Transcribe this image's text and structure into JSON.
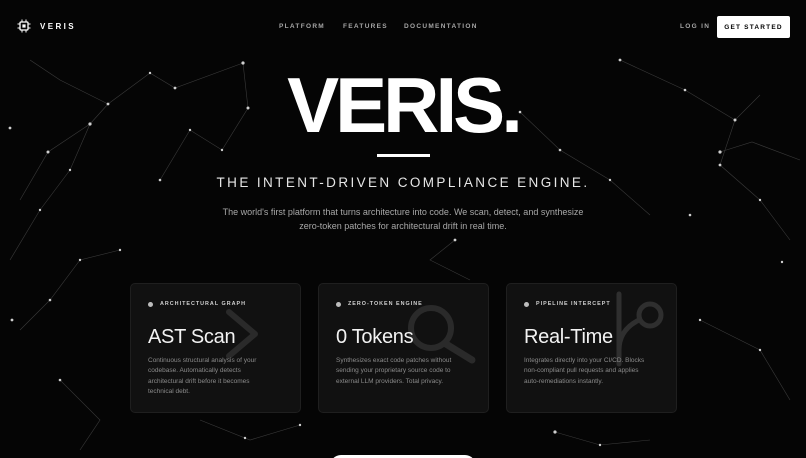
{
  "nav": {
    "brand": "VERIS",
    "links": [
      "PLATFORM",
      "FEATURES",
      "DOCUMENTATION"
    ],
    "login": "LOG IN",
    "cta": "GET STARTED"
  },
  "hero": {
    "title": "VERIS.",
    "subtitle": "THE INTENT-DRIVEN COMPLIANCE ENGINE.",
    "description": "The world's first platform that turns architecture into code. We scan, detect, and synthesize zero-token patches for architectural drift in real time."
  },
  "cards": [
    {
      "label": "ARCHITECTURAL GRAPH",
      "title": "AST Scan",
      "body": "Continuous structural analysis of your codebase. Automatically detects architectural drift before it becomes technical debt.",
      "art_icon": "chevron-icon"
    },
    {
      "label": "ZERO-TOKEN ENGINE",
      "title": "0 Tokens",
      "body": "Synthesizes exact code patches without sending your proprietary source code to external LLM providers. Total privacy.",
      "art_icon": "magnifier-icon"
    },
    {
      "label": "PIPELINE INTERCEPT",
      "title": "Real-Time",
      "body": "Integrates directly into your CI/CD. Blocks non-compliant pull requests and applies auto-remediations instantly.",
      "art_icon": "git-branch-icon"
    }
  ],
  "colors": {
    "background": "#050505",
    "text": "#ffffff",
    "muted": "#a6a6a6",
    "card": "#161616"
  }
}
